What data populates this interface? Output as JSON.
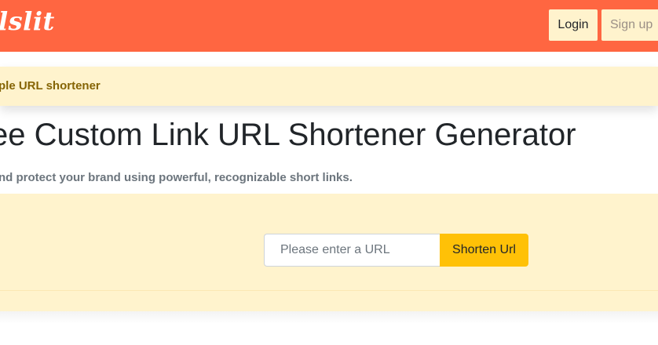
{
  "navbar": {
    "brand": "lslit",
    "login_label": "Login",
    "signup_label": "Sign up"
  },
  "alert": {
    "text": "ple URL shortener"
  },
  "hero": {
    "title": "ee Custom Link URL Shortener Generator",
    "subtitle": "nd protect your brand using powerful, recognizable short links."
  },
  "form": {
    "input_placeholder": "Please enter a URL",
    "input_value": "",
    "submit_label": "Shorten Url"
  },
  "colors": {
    "navbar": "#ff6641",
    "alert_bg": "#fff3cd",
    "alert_text": "#856404",
    "button_accent": "#ffc107"
  }
}
